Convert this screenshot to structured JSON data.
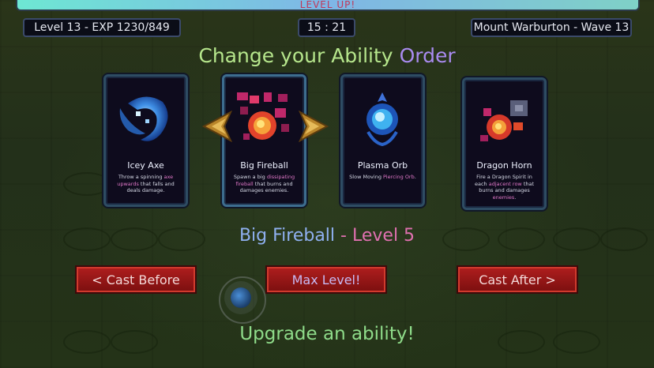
{
  "hud": {
    "level_up_text": "LEVEL UP!",
    "level_exp": "Level 13 - EXP 1230/849",
    "timer": "15 : 21",
    "location_wave": "Mount Warburton - Wave 13"
  },
  "title": {
    "part1": "Change your Ability ",
    "part2": "Order"
  },
  "cards": [
    {
      "name": "Icey Axe",
      "desc_parts": [
        "Throw a spinning ",
        "axe upwards",
        " that falls and deals damage."
      ],
      "icon": "ice-axe-icon"
    },
    {
      "name": "Big Fireball",
      "desc_parts": [
        "Spawn a big ",
        "dissipating fireball",
        " that burns and damages enemies."
      ],
      "icon": "fireball-icon"
    },
    {
      "name": "Plasma Orb",
      "desc_parts": [
        "Slow Moving ",
        "Piercing Orb",
        "."
      ],
      "icon": "plasma-orb-icon"
    },
    {
      "name": "Dragon Horn",
      "desc_parts": [
        "Fire a Dragon Spirit in each ",
        "adjacent row",
        " that burns and damages ",
        "enemies",
        "."
      ],
      "icon": "dragon-horn-icon"
    }
  ],
  "selected": {
    "name": "Big Fireball",
    "separator": " - ",
    "level": "Level 5"
  },
  "buttons": {
    "cast_before": "< Cast Before",
    "max_level": "Max Level!",
    "cast_after": "Cast After >"
  },
  "prompt": "Upgrade an ability!",
  "colors": {
    "accent_green": "#b6e68c",
    "accent_purple": "#a98bf0",
    "keyword_pink": "#e078c8",
    "button_red": "#b01e1e",
    "arrow_gold": "#c8922c"
  }
}
